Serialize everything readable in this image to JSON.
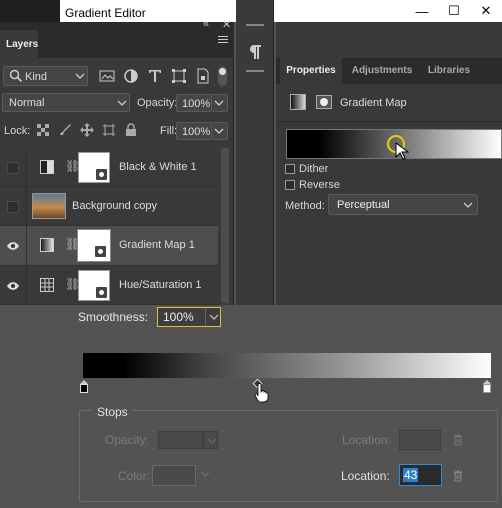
{
  "window": {
    "title": "Gradient Editor",
    "minimize": "—",
    "maximize": "☐",
    "close": "✕"
  },
  "layers_panel": {
    "tab": "Layers",
    "collapse": "«",
    "close": "✕",
    "filter": {
      "label": "Kind"
    },
    "blend_mode": "Normal",
    "opacity_label": "Opacity:",
    "opacity_value": "100%",
    "lock_label": "Lock:",
    "fill_label": "Fill:",
    "fill_value": "100%",
    "layers": [
      {
        "name": "Black & White 1",
        "visible": false,
        "selected": false
      },
      {
        "name": "Background copy",
        "visible": false,
        "selected": false
      },
      {
        "name": "Gradient Map 1",
        "visible": true,
        "selected": true
      },
      {
        "name": "Hue/Saturation 1",
        "visible": true,
        "selected": false
      }
    ]
  },
  "properties_panel": {
    "tabs": [
      "Properties",
      "Adjustments",
      "Libraries"
    ],
    "active_tab": "Properties",
    "title": "Gradient Map",
    "dither_label": "Dither",
    "reverse_label": "Reverse",
    "method_label": "Method:",
    "method_value": "Perceptual"
  },
  "gradient_editor": {
    "smoothness_label": "Smoothness:",
    "smoothness_value": "100%",
    "stops_label": "Stops",
    "opacity_label": "Opacity:",
    "location_label": "Location:",
    "color_label": "Color:",
    "color_location_value": "43",
    "midpoint_percent": 43
  }
}
